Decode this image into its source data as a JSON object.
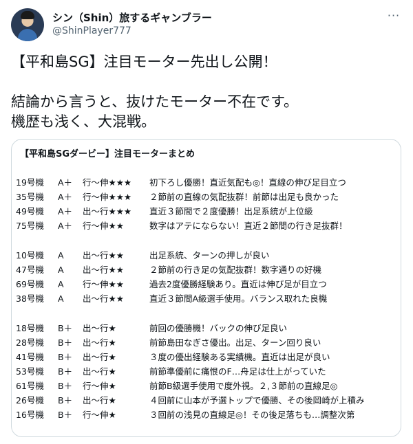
{
  "author": {
    "name": "シン（Shin）旅するギャンブラー",
    "handle": "@ShinPlayer777"
  },
  "more_icon": "more-dots-icon",
  "tweet": {
    "lines": [
      "【平和島SG】注目モーター先出し公開！",
      "",
      "結論から言うと、抜けたモーター不在です。",
      "機歴も浅く、大混戦。"
    ]
  },
  "card": {
    "title": "【平和島SGダービー】注目モーターまとめ",
    "groups": [
      [
        {
          "no": "19号機",
          "rank": "A＋",
          "type": "行〜伸★★★",
          "note": "初下ろし優勝！直近気配も◎！直線の伸び足目立つ"
        },
        {
          "no": "35号機",
          "rank": "A＋",
          "type": "行〜伸★★★",
          "note": "２節前の直線の気配抜群！前節は出足も良かった"
        },
        {
          "no": "49号機",
          "rank": "A＋",
          "type": "出〜行★★★",
          "note": "直近３節間で２度優勝！出足系統が上位級"
        },
        {
          "no": "75号機",
          "rank": "A＋",
          "type": "行〜伸★★",
          "note": "数字はアテにならない！直近２節間の行き足抜群！"
        }
      ],
      [
        {
          "no": "10号機",
          "rank": "A",
          "type": "出〜行★★",
          "note": "出足系統、ターンの押しが良い"
        },
        {
          "no": "47号機",
          "rank": "A",
          "type": "出〜行★★",
          "note": "２節前の行き足の気配抜群！数字通りの好機"
        },
        {
          "no": "69号機",
          "rank": "A",
          "type": "行〜伸★★",
          "note": "過去2度優勝経験あり。直近は伸び足が目立つ"
        },
        {
          "no": "38号機",
          "rank": "A",
          "type": "出〜行★★",
          "note": "直近３節間A級選手使用。バランス取れた良機"
        }
      ],
      [
        {
          "no": "18号機",
          "rank": "B＋",
          "type": "出〜行★",
          "note": "前回の優勝機！バックの伸び足良い"
        },
        {
          "no": "28号機",
          "rank": "B＋",
          "type": "出〜行★",
          "note": "前節島田なぎさ優出。出足、ターン回り良い"
        },
        {
          "no": "41号機",
          "rank": "B＋",
          "type": "出〜行★",
          "note": "３度の優出経験ある実績機。直近は出足が良い"
        },
        {
          "no": "53号機",
          "rank": "B＋",
          "type": "出〜行★",
          "note": "前節準優前に痛恨のF…舟足は仕上がっていた"
        },
        {
          "no": "61号機",
          "rank": "B＋",
          "type": "行〜伸★",
          "note": "前節B級選手使用で度外視。２,３節前の直線足◎"
        },
        {
          "no": "26号機",
          "rank": "B＋",
          "type": "出〜行★",
          "note": "４回前に山本が予選トップで優勝、その後岡崎が上積み"
        },
        {
          "no": "16号機",
          "rank": "B＋",
          "type": "行〜伸★",
          "note": "３回前の浅見の直線足◎！その後足落ちも…調整次第"
        }
      ]
    ]
  }
}
